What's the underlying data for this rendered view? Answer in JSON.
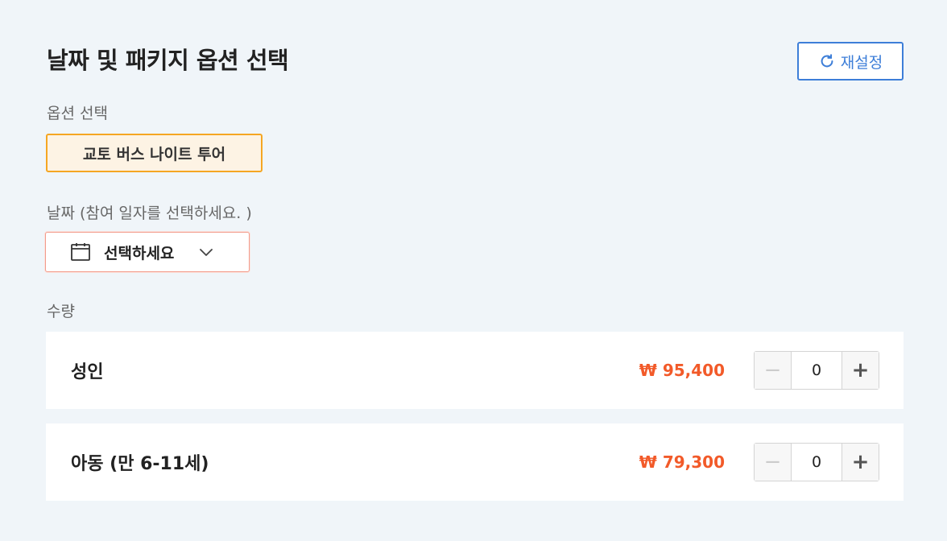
{
  "header": {
    "title": "날짜 및 패키지 옵션 선택",
    "reset_label": "재설정"
  },
  "option": {
    "label": "옵션 선택",
    "selected": "교토 버스 나이트 투어"
  },
  "date": {
    "label": "날짜  (참여 일자를 선택하세요. )",
    "placeholder": "선택하세요"
  },
  "quantity": {
    "label": "수량",
    "rows": [
      {
        "label": "성인",
        "price": "₩ 95,400",
        "count": "0"
      },
      {
        "label": "아동 (만 6-11세)",
        "price": "₩ 79,300",
        "count": "0"
      }
    ]
  },
  "colors": {
    "accent_blue": "#3d7ed8",
    "chip_border": "#f5a623",
    "price": "#f25a29"
  },
  "icons": {
    "reset": "refresh-icon",
    "date": "calendar-icon",
    "dropdown": "chevron-down-icon"
  }
}
